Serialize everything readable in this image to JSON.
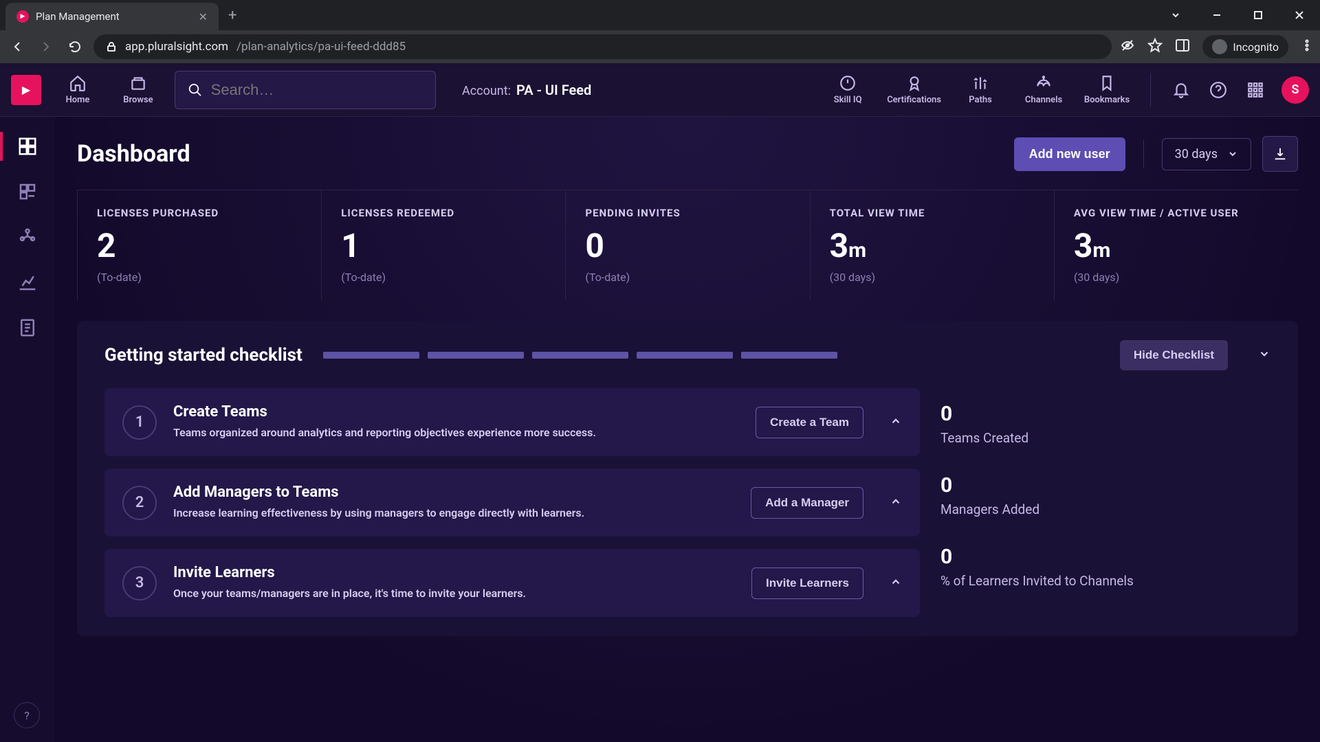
{
  "browser": {
    "tab_title": "Plan Management",
    "url_domain": "app.pluralsight.com",
    "url_path": "/plan-analytics/pa-ui-feed-ddd85",
    "incognito_label": "Incognito"
  },
  "nav": {
    "home": "Home",
    "browse": "Browse",
    "search_placeholder": "Search…",
    "account_label": "Account:",
    "account_name": "PA - UI Feed",
    "skilliq": "Skill IQ",
    "certifications": "Certifications",
    "paths": "Paths",
    "channels": "Channels",
    "bookmarks": "Bookmarks",
    "avatar_letter": "S"
  },
  "page": {
    "title": "Dashboard",
    "add_user": "Add new user",
    "range": "30 days"
  },
  "stats": [
    {
      "label": "Licenses Purchased",
      "value": "2",
      "unit": "",
      "sub": "(To-date)"
    },
    {
      "label": "Licenses Redeemed",
      "value": "1",
      "unit": "",
      "sub": "(To-date)"
    },
    {
      "label": "Pending Invites",
      "value": "0",
      "unit": "",
      "sub": "(To-date)"
    },
    {
      "label": "Total View Time",
      "value": "3",
      "unit": "m",
      "sub": "(30 days)"
    },
    {
      "label": "Avg View Time / Active User",
      "value": "3",
      "unit": "m",
      "sub": "(30 days)"
    }
  ],
  "checklist": {
    "title": "Getting started checklist",
    "hide": "Hide Checklist",
    "items": [
      {
        "num": "1",
        "title": "Create Teams",
        "desc": "Teams organized around analytics and reporting objectives experience more success.",
        "cta": "Create a Team"
      },
      {
        "num": "2",
        "title": "Add Managers to Teams",
        "desc": "Increase learning effectiveness by using managers to engage directly with learners.",
        "cta": "Add a Manager"
      },
      {
        "num": "3",
        "title": "Invite Learners",
        "desc": "Once your teams/managers are in place, it's time to invite your learners.",
        "cta": "Invite Learners"
      }
    ],
    "side_stats": [
      {
        "value": "0",
        "label": "Teams Created"
      },
      {
        "value": "0",
        "label": "Managers Added"
      },
      {
        "value": "0",
        "label": "% of Learners Invited to Channels"
      }
    ]
  }
}
